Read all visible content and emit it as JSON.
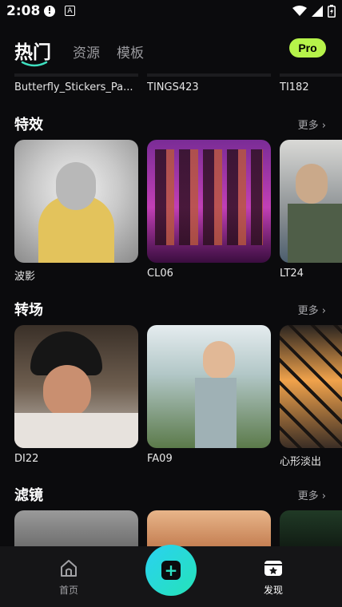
{
  "status_bar": {
    "time": "2:08",
    "icons": [
      "alert-icon",
      "app-a-icon",
      "wifi-icon",
      "signal-icon",
      "battery-icon"
    ]
  },
  "header": {
    "tabs": [
      {
        "label": "热门",
        "active": true
      },
      {
        "label": "资源",
        "active": false
      },
      {
        "label": "模板",
        "active": false
      }
    ],
    "pro_label": "Pro"
  },
  "previous_row": {
    "labels": [
      "Butterfly_Stickers_Pa...",
      "TINGS423",
      "TI182"
    ]
  },
  "sections": [
    {
      "title": "特效",
      "more": "更多",
      "items": [
        {
          "label": "波影"
        },
        {
          "label": "CL06"
        },
        {
          "label": "LT24"
        }
      ]
    },
    {
      "title": "转场",
      "more": "更多",
      "items": [
        {
          "label": "DI22"
        },
        {
          "label": "FA09"
        },
        {
          "label": "心形淡出"
        }
      ]
    },
    {
      "title": "滤镜",
      "more": "更多",
      "items": [
        {
          "label": ""
        },
        {
          "label": ""
        },
        {
          "label": ""
        }
      ]
    }
  ],
  "bottom_nav": {
    "home_label": "首页",
    "discover_label": "发现"
  },
  "colors": {
    "accent_pro": "#b6f34a",
    "fab_gradient_start": "#2ad1f2",
    "fab_gradient_end": "#25e3b8",
    "background": "#0b0b0d"
  }
}
